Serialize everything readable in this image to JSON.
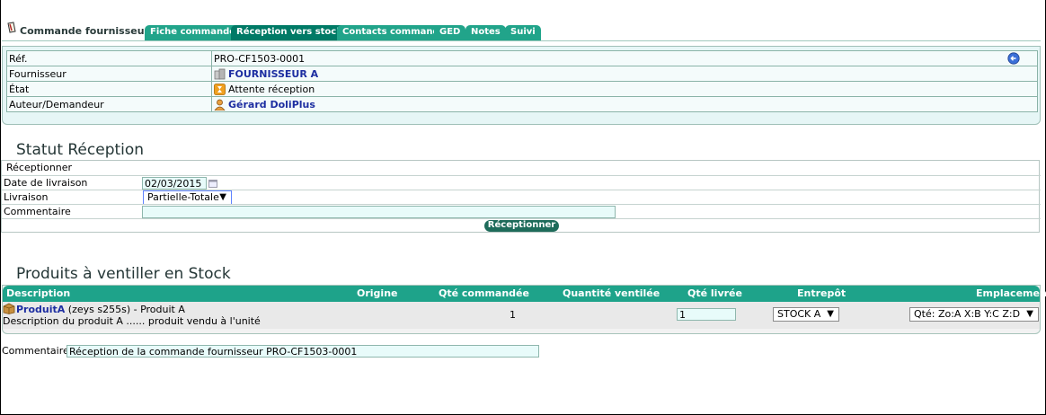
{
  "header": {
    "title": "Commande fournisseur",
    "tabs": [
      {
        "label": "Fiche commande",
        "active": false
      },
      {
        "label": "Réception vers stocks",
        "active": true
      },
      {
        "label": "Contacts commande",
        "active": false
      },
      {
        "label": "GED",
        "active": false
      },
      {
        "label": "Notes",
        "active": false
      },
      {
        "label": "Suivi",
        "active": false
      }
    ]
  },
  "card": {
    "rows": [
      {
        "label": "Réf.",
        "value": "PRO-CF1503-0001"
      },
      {
        "label": "Fournisseur",
        "value": "FOURNISSEUR A",
        "icon": "company-icon"
      },
      {
        "label": "État",
        "value": "Attente réception",
        "icon": "status-icon"
      },
      {
        "label": "Auteur/Demandeur",
        "value": "Gérard DoliPlus",
        "icon": "user-icon"
      }
    ],
    "back_icon": "back-arrow-icon"
  },
  "reception": {
    "title": "Statut Réception",
    "header": "Réceptionner",
    "date_label": "Date de livraison",
    "date_value": "02/03/2015",
    "livraison_label": "Livraison",
    "livraison_value": "Partielle-Totale",
    "comment_label": "Commentaire",
    "comment_value": "",
    "button": "Réceptionner"
  },
  "products": {
    "title": "Produits à ventiller en Stock",
    "columns": [
      "Description",
      "Origine",
      "Qté commandée",
      "Quantité ventilée",
      "Qté livrée",
      "Entrepôt",
      "Emplacement"
    ],
    "rows": [
      {
        "ref": "ProduitA",
        "ref_extra": "(zeys s255s) - Produit A",
        "description": "Description du produit A ...... produit vendu à l'unité",
        "origine": "",
        "qte_commandee": "1",
        "quantite_ventilee": "",
        "qte_livree": "1",
        "entrepot": "STOCK A",
        "emplacement": "Qté: Zo:A X:B Y:C Z:D"
      }
    ]
  },
  "comment": {
    "label": "Commentaire :",
    "value": "Réception de la commande fournisseur PRO-CF1503-0001"
  },
  "colors": {
    "tab": "#21a48a",
    "tab_active": "#007a66",
    "link": "#1d2ea1",
    "button": "#1e6b5a"
  }
}
